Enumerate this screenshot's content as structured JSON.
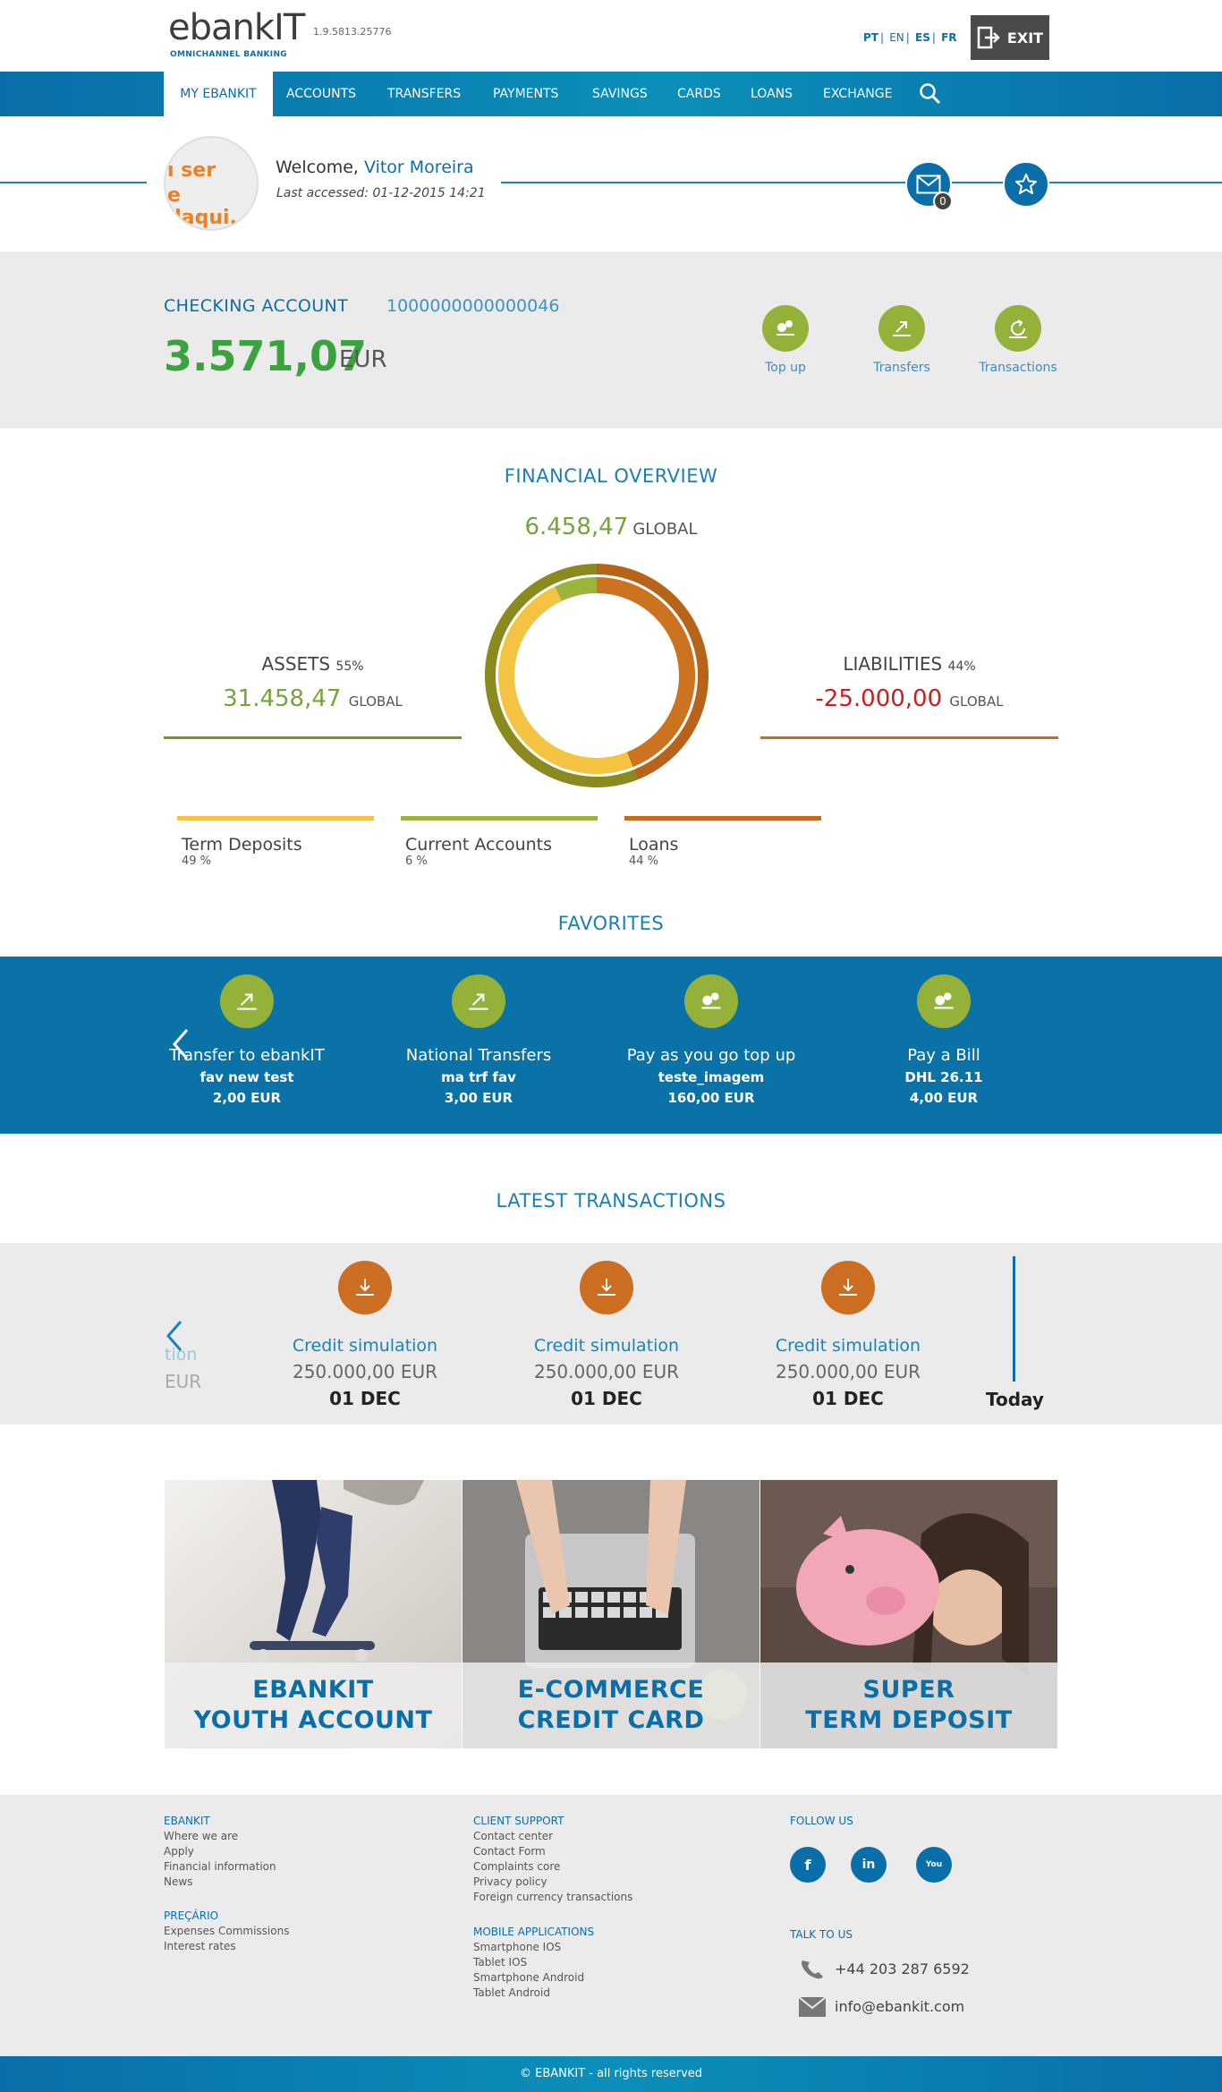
{
  "header": {
    "logo": "ebankIT",
    "version": "1.9.5813.25776",
    "tagline": "OMNICHANNEL BANKING",
    "languages": [
      "PT",
      "EN",
      "ES",
      "FR"
    ],
    "exit_label": "EXIT"
  },
  "nav": {
    "items": [
      "MY EBANKIT",
      "ACCOUNTS",
      "TRANSFERS",
      "PAYMENTS",
      "SAVINGS",
      "CARDS",
      "LOANS",
      "EXCHANGE"
    ],
    "active": "MY EBANKIT",
    "search_icon": "search-icon"
  },
  "welcome": {
    "avatar_text_1": "ı ser",
    "avatar_text_2": "e daqui.",
    "greeting": "Welcome,",
    "name": "Vitor Moreira",
    "last_accessed": "Last accessed: 01-12-2015 14:21",
    "messages_count": "0"
  },
  "account": {
    "title": "CHECKING ACCOUNT",
    "number": "1000000000000046",
    "balance": "3.571,07",
    "currency": "EUR",
    "actions": [
      "Top up",
      "Transfers",
      "Transactions"
    ]
  },
  "overview": {
    "title": "FINANCIAL OVERVIEW",
    "global_value": "6.458,47",
    "global_label": "GLOBAL",
    "assets": {
      "label": "ASSETS",
      "percent": "55%",
      "value": "31.458,47",
      "unit": "GLOBAL"
    },
    "liabilities": {
      "label": "LIABILITIES",
      "percent": "44%",
      "value": "-25.000,00",
      "unit": "GLOBAL"
    },
    "legend": [
      {
        "name": "Term Deposits",
        "percent": "49 %",
        "color": "#f5c342"
      },
      {
        "name": "Current Accounts",
        "percent": "6 %",
        "color": "#9bb53c"
      },
      {
        "name": "Loans",
        "percent": "44 %",
        "color": "#c96a1c"
      }
    ],
    "ring": {
      "term_deposits": 49,
      "current_accounts": 6,
      "loans": 44,
      "assets_pct": 55,
      "liabilities_pct": 44
    }
  },
  "favorites": {
    "title": "FAVORITES",
    "items": [
      {
        "title": "Transfer to ebankIT",
        "subtitle": "fav new test",
        "amount": "2,00 EUR"
      },
      {
        "title": "National Transfers",
        "subtitle": "ma trf fav",
        "amount": "3,00 EUR"
      },
      {
        "title": "Pay as you go top up",
        "subtitle": "teste_imagem",
        "amount": "160,00 EUR"
      },
      {
        "title": "Pay a Bill",
        "subtitle": "DHL 26.11",
        "amount": "4,00 EUR"
      }
    ]
  },
  "transactions": {
    "title": "LATEST TRANSACTIONS",
    "partial_title": "tion",
    "partial_value": "EUR",
    "items": [
      {
        "title": "Credit simulation",
        "value": "250.000,00 EUR",
        "date": "01 DEC"
      },
      {
        "title": "Credit simulation",
        "value": "250.000,00 EUR",
        "date": "01 DEC"
      },
      {
        "title": "Credit simulation",
        "value": "250.000,00 EUR",
        "date": "01 DEC"
      }
    ],
    "today_label": "Today"
  },
  "promos": [
    {
      "line1": "EBANKIT",
      "line2": "YOUTH ACCOUNT"
    },
    {
      "line1": "E-COMMERCE",
      "line2": "CREDIT CARD"
    },
    {
      "line1": "SUPER",
      "line2": "TERM DEPOSIT"
    }
  ],
  "footer": {
    "ebankit": {
      "heading": "EBANKIT",
      "links": [
        "Where we are",
        "Apply",
        "Financial information",
        "News"
      ]
    },
    "precario": {
      "heading": "PREÇÁRIO",
      "links": [
        "Expenses Commissions",
        "Interest rates"
      ]
    },
    "client_support": {
      "heading": "CLIENT SUPPORT",
      "links": [
        "Contact center",
        "Contact Form",
        "Complaints core",
        "Privacy policy",
        "Foreign currency transactions"
      ]
    },
    "mobile": {
      "heading": "MOBILE APPLICATIONS",
      "links": [
        "Smartphone IOS",
        "Tablet IOS",
        "Smartphone Android",
        "Tablet Android"
      ]
    },
    "follow": {
      "heading": "FOLLOW US",
      "icons": [
        "f",
        "in",
        "You"
      ]
    },
    "talk": {
      "heading": "TALK TO US",
      "phone": "+44 203 287 6592",
      "email": "info@ebankit.com"
    },
    "copyright": "© EBANKIT - all rights reserved"
  },
  "colors": {
    "brand_blue": "#0a6fa8",
    "green": "#94b23a",
    "orange": "#cc6e21",
    "balance_green": "#3aa33e",
    "liability_red": "#c8201f"
  }
}
